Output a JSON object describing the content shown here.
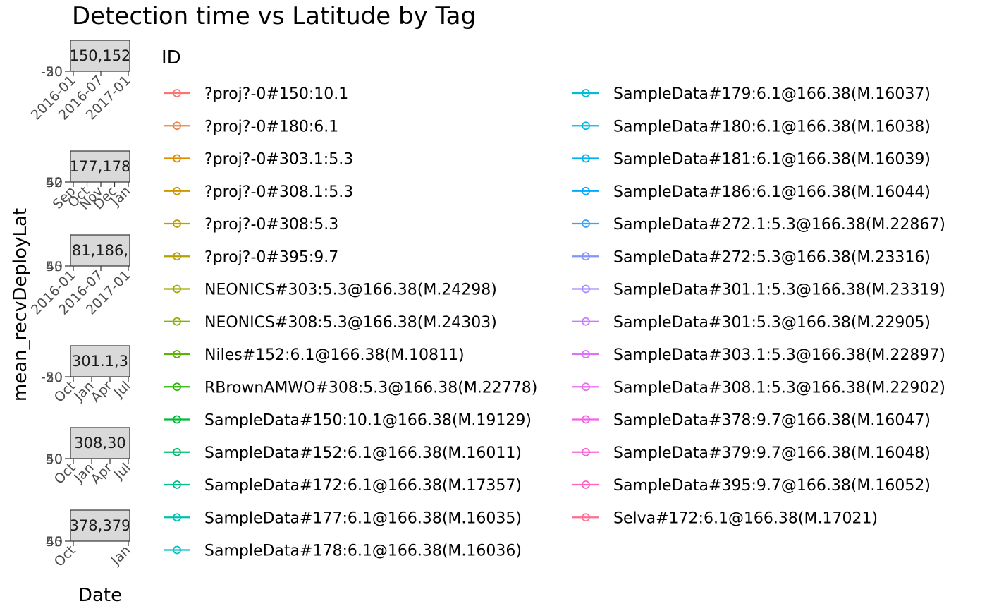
{
  "chart_data": {
    "type": "line",
    "title": "Detection time vs Latitude by Tag",
    "xlabel": "Date",
    "ylabel": "mean_recvDeployLat",
    "grid": false,
    "legend_position": "right",
    "legend_title": "ID",
    "panels": [
      {
        "strip": "150,152",
        "x_ticks": [
          "2016-01",
          "2016-07",
          "2017-01"
        ],
        "y_ticks": [
          "-20",
          "50"
        ]
      },
      {
        "strip": "177,178",
        "x_ticks": [
          "Sep",
          "Oct",
          "Nov",
          "Dec",
          "Jan"
        ],
        "y_ticks": [
          "40",
          "50",
          "52"
        ]
      },
      {
        "strip": "81,186,",
        "x_ticks": [
          "2016-01",
          "2016-07",
          "2017-01"
        ],
        "y_ticks": [
          "45",
          "50"
        ]
      },
      {
        "strip": "301.1,3",
        "x_ticks": [
          "Oct",
          "Jan",
          "Apr",
          "Jul"
        ],
        "y_ticks": [
          "-20",
          "50"
        ]
      },
      {
        "strip": "308,30",
        "x_ticks": [
          "Oct",
          "Jan",
          "Apr",
          "Jul"
        ],
        "y_ticks": [
          "40",
          "50"
        ]
      },
      {
        "strip": "378,379",
        "x_ticks": [
          "Oct",
          "Jan"
        ],
        "y_ticks": [
          "40",
          "45",
          "50"
        ]
      }
    ],
    "series": [
      {
        "name": "?proj?-0#150:10.1",
        "color": "#F8766D"
      },
      {
        "name": "?proj?-0#180:6.1",
        "color": "#EE8043"
      },
      {
        "name": "?proj?-0#303.1:5.3",
        "color": "#DE8C00"
      },
      {
        "name": "?proj?-0#308.1:5.3",
        "color": "#CD9600"
      },
      {
        "name": "?proj?-0#308:5.3",
        "color": "#BC9E00"
      },
      {
        "name": "?proj?-0#395:9.7",
        "color": "#B79F00"
      },
      {
        "name": "NEONICS#303:5.3@166.38(M.24298)",
        "color": "#9EAA00"
      },
      {
        "name": "NEONICS#308:5.3@166.38(M.24303)",
        "color": "#86B300"
      },
      {
        "name": "Niles#152:6.1@166.38(M.10811)",
        "color": "#5EB300"
      },
      {
        "name": "RBrownAMWO#308:5.3@166.38(M.22778)",
        "color": "#29B600"
      },
      {
        "name": "SampleData#150:10.1@166.38(M.19129)",
        "color": "#00BA38"
      },
      {
        "name": "SampleData#152:6.1@166.38(M.16011)",
        "color": "#00BD6B"
      },
      {
        "name": "SampleData#172:6.1@166.38(M.17357)",
        "color": "#00BF8E"
      },
      {
        "name": "SampleData#177:6.1@166.38(M.16035)",
        "color": "#00C0AF"
      },
      {
        "name": "SampleData#178:6.1@166.38(M.16036)",
        "color": "#00BFC4"
      },
      {
        "name": "SampleData#179:6.1@166.38(M.16037)",
        "color": "#00BCD8"
      },
      {
        "name": "SampleData#180:6.1@166.38(M.16038)",
        "color": "#00B8E7"
      },
      {
        "name": "SampleData#181:6.1@166.38(M.16039)",
        "color": "#00B4F0"
      },
      {
        "name": "SampleData#186:6.1@166.38(M.16044)",
        "color": "#00A9FF"
      },
      {
        "name": "SampleData#272.1:5.3@166.38(M.22867)",
        "color": "#35A2FF"
      },
      {
        "name": "SampleData#272:5.3@166.38(M.23316)",
        "color": "#8494FF"
      },
      {
        "name": "SampleData#301.1:5.3@166.38(M.23319)",
        "color": "#A58AFF"
      },
      {
        "name": "SampleData#301:5.3@166.38(M.22905)",
        "color": "#C77CFF"
      },
      {
        "name": "SampleData#303.1:5.3@166.38(M.22897)",
        "color": "#DC71FA"
      },
      {
        "name": "SampleData#308.1:5.3@166.38(M.22902)",
        "color": "#EA6AF1"
      },
      {
        "name": "SampleData#378:9.7@166.38(M.16047)",
        "color": "#F564E3"
      },
      {
        "name": "SampleData#379:9.7@166.38(M.16048)",
        "color": "#FB61D7"
      },
      {
        "name": "SampleData#395:9.7@166.38(M.16052)",
        "color": "#FF62BC"
      },
      {
        "name": "Selva#172:6.1@166.38(M.17021)",
        "color": "#FF6C91"
      }
    ]
  }
}
